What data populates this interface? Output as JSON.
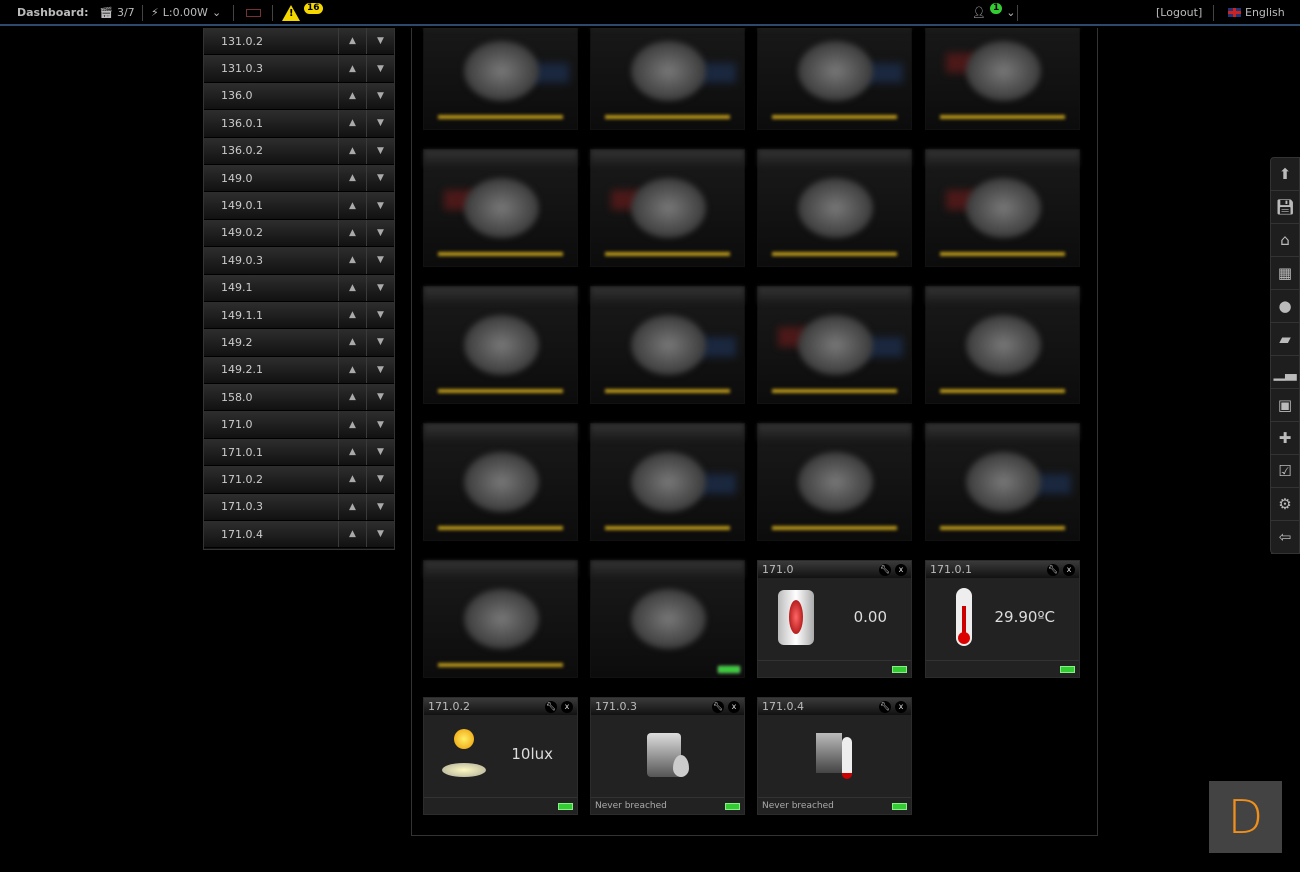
{
  "topbar": {
    "dashboard_label": "Dashboard:",
    "scenes": "3/7",
    "power": "L:0.00W",
    "alerts_count": "16",
    "user_badge": "1",
    "logout": "[Logout]",
    "language": "English"
  },
  "sidebar": {
    "items": [
      "131.0.2",
      "131.0.3",
      "136.0",
      "136.0.1",
      "136.0.2",
      "149.0",
      "149.0.1",
      "149.0.2",
      "149.0.3",
      "149.1",
      "149.1.1",
      "149.2",
      "149.2.1",
      "158.0",
      "171.0",
      "171.0.1",
      "171.0.2",
      "171.0.3",
      "171.0.4"
    ],
    "up": "▲",
    "down": "▼"
  },
  "widgets": [
    {
      "title": "171.0",
      "value": "0.00",
      "icon": "siren-icon",
      "footer": ""
    },
    {
      "title": "171.0.1",
      "value": "29.90ºC",
      "icon": "thermometer-icon",
      "footer": ""
    },
    {
      "title": "171.0.2",
      "value": "10lux",
      "icon": "light-sensor-icon",
      "footer": ""
    },
    {
      "title": "171.0.3",
      "value": "",
      "icon": "water-sensor-icon",
      "footer": "Never breached"
    },
    {
      "title": "171.0.4",
      "value": "",
      "icon": "heat-detector-icon",
      "footer": "Never breached"
    }
  ],
  "toolbar": [
    "arrow-up-icon",
    "save-icon",
    "home-icon",
    "devices-icon",
    "map-pin-icon",
    "scene-icon",
    "chart-icon",
    "package-icon",
    "puzzle-icon",
    "calendar-check-icon",
    "settings-icon",
    "logout-icon"
  ],
  "logo": "D",
  "colors": {
    "accent": "#2d4a6a",
    "alert": "#f5d800",
    "logo": "#f0901a",
    "battery": "#33cc33"
  }
}
